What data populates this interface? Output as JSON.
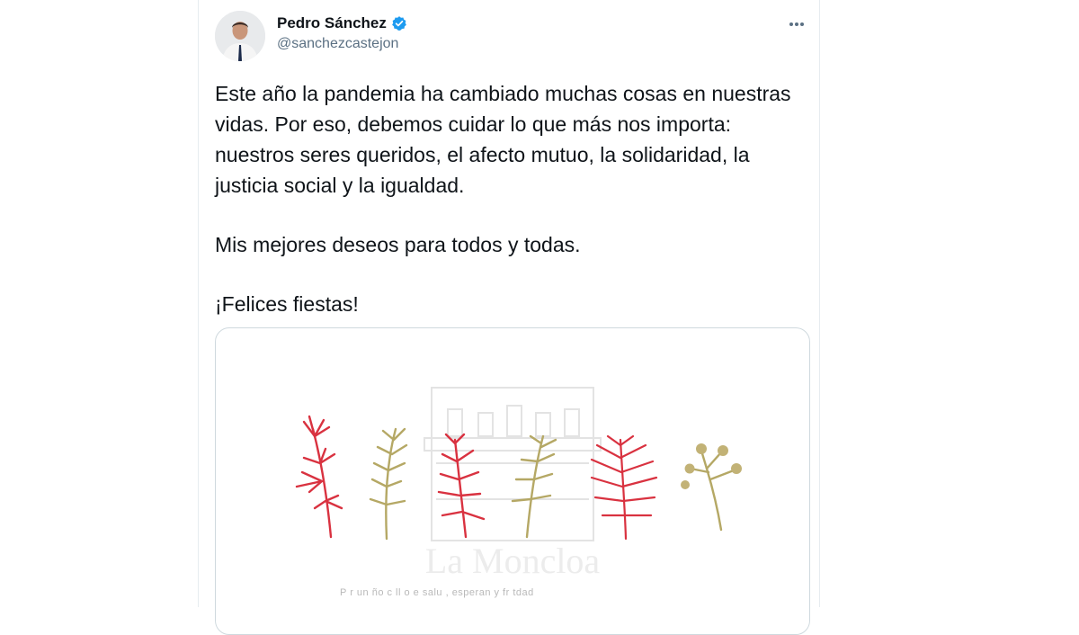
{
  "tweet": {
    "author_name": "Pedro Sánchez",
    "author_handle": "@sanchezcastejon",
    "paragraphs": [
      "Este año la pandemia ha cambiado muchas cosas en nuestras vidas. Por eso, debemos cuidar lo que más nos importa: nuestros seres queridos, el afecto mutuo, la solidaridad, la justicia social y la igualdad.",
      "Mis mejores deseos para todos y todas.",
      "¡Felices fiestas!"
    ]
  },
  "card": {
    "logo_text": "La Moncloa",
    "footer_text": "P r un    ño c   ll   o   e salu , esperan   y fr    tdad"
  },
  "colors": {
    "verified": "#1d9bf0",
    "red_plant": "#d93240",
    "olive_plant": "#b5a865",
    "building": "#e5e5e5"
  },
  "icons": {
    "verified": "verified-badge-icon",
    "more": "more-options-icon"
  }
}
